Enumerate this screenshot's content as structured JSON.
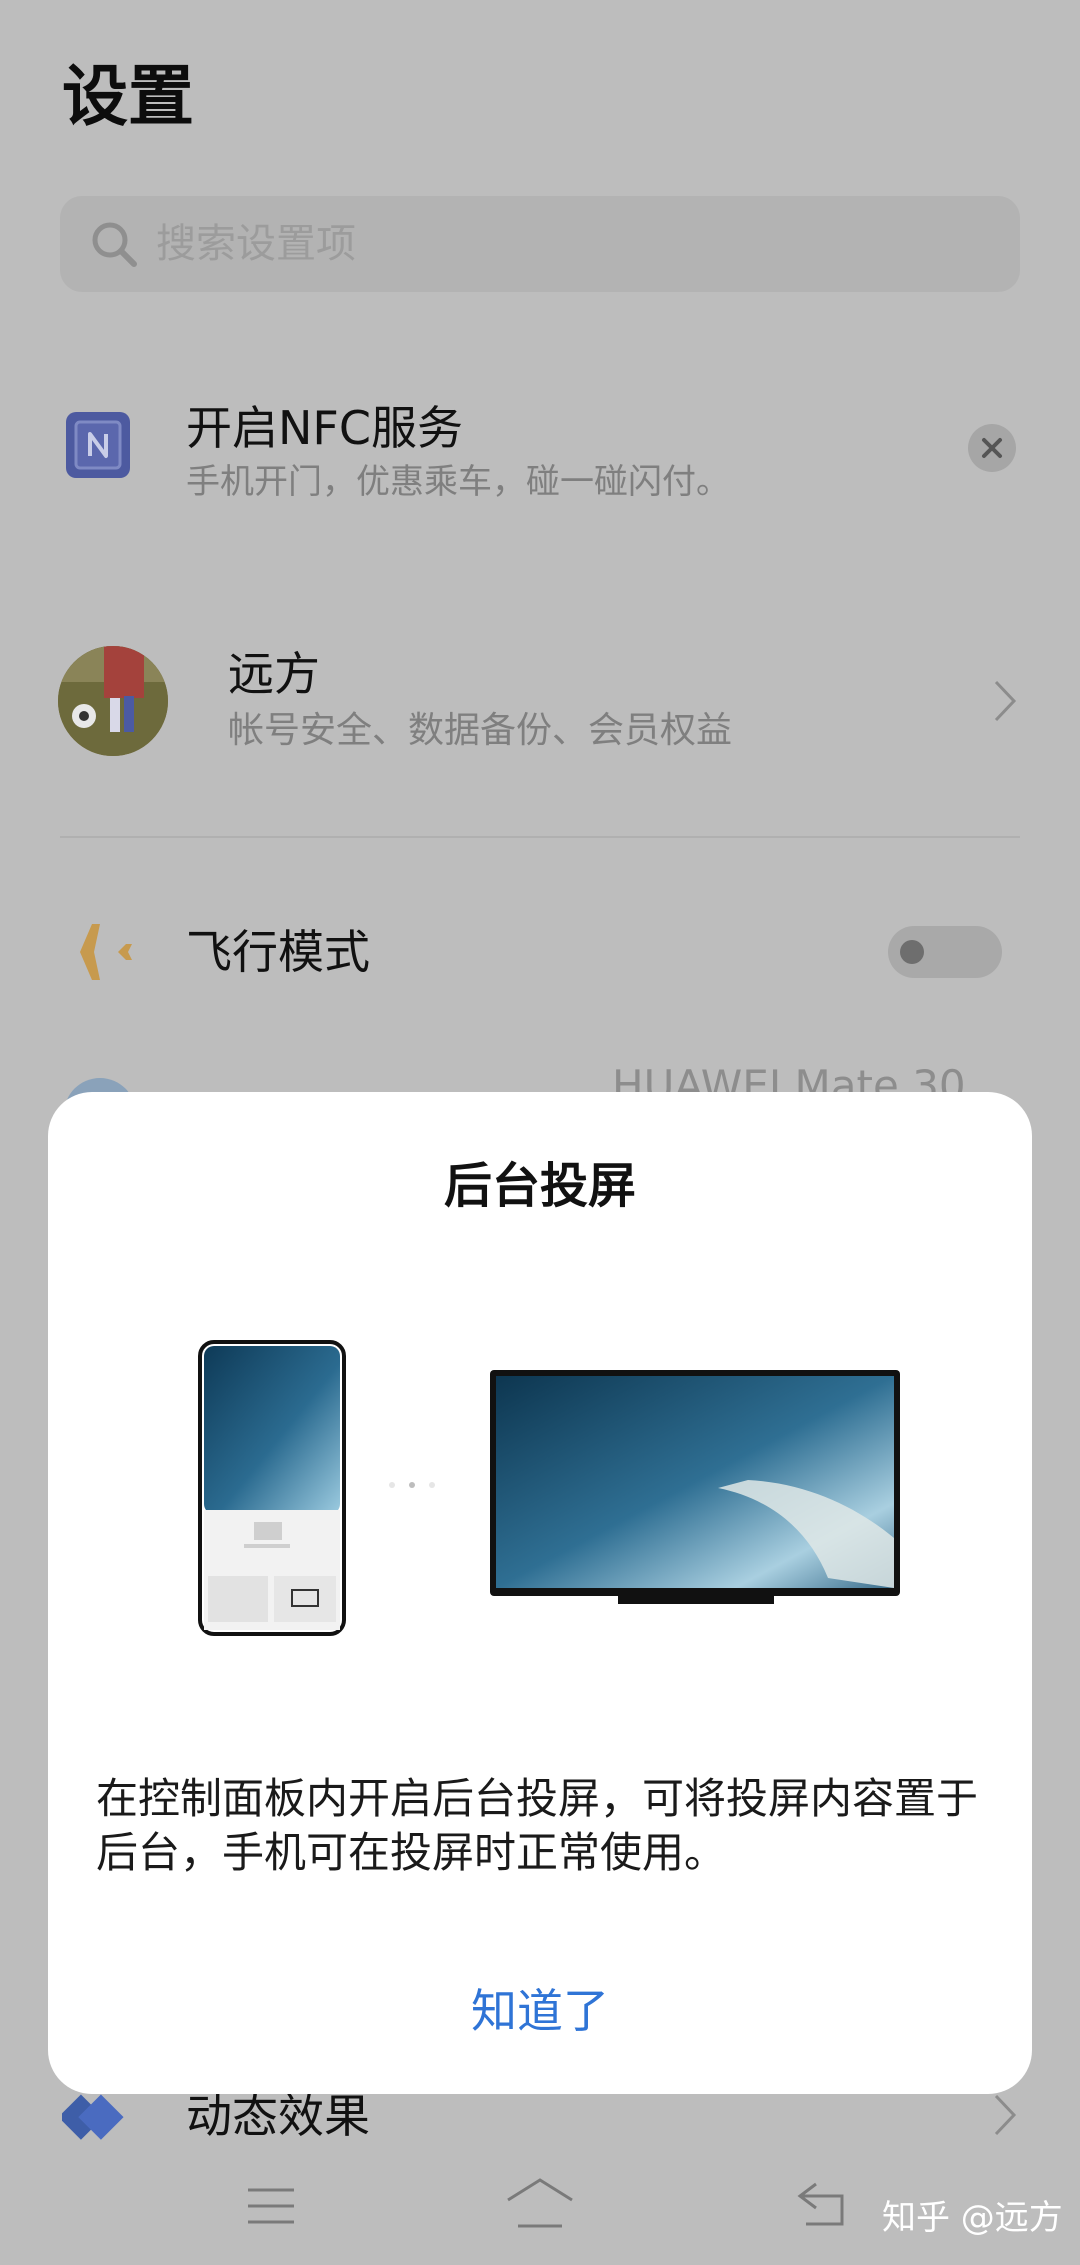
{
  "settings": {
    "title": "设置",
    "search": {
      "placeholder": "搜索设置项"
    },
    "nfc_card": {
      "title": "开启NFC服务",
      "subtitle": "手机开门，优惠乘车，碰一碰闪付。"
    },
    "account": {
      "name": "远方",
      "subtitle": "帐号安全、数据备份、会员权益"
    },
    "airplane_mode": {
      "label": "飞行模式",
      "enabled": false
    },
    "partial_row": {
      "value": "HUAWEI Mate 30"
    },
    "animation": {
      "label": "动态效果"
    }
  },
  "dialog": {
    "title": "后台投屏",
    "body": "在控制面板内开启后台投屏，可将投屏内容置于后台，手机可在投屏时正常使用。",
    "confirm_label": "知道了"
  },
  "watermark": "知乎 @远方",
  "colors": {
    "accent": "#2f74d6",
    "overlay_background": "#bdbdbd",
    "airplane_icon": "#c79a4e",
    "nfc_icon": "#4d5aa0"
  }
}
